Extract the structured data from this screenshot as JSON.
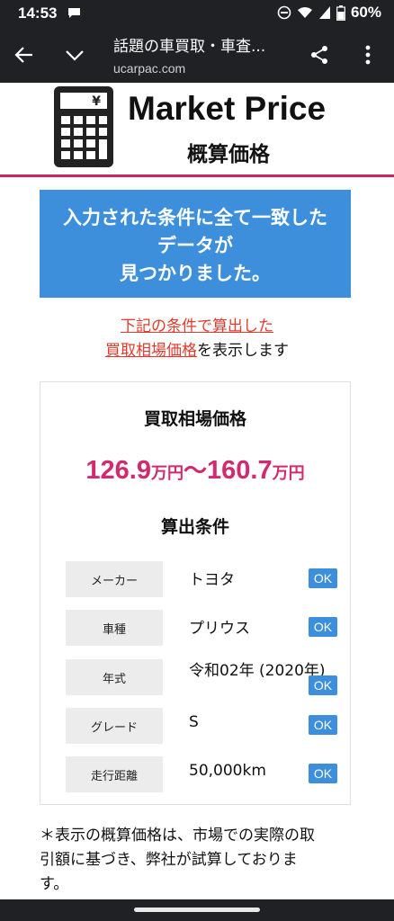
{
  "status": {
    "time": "14:53",
    "battery": "60%"
  },
  "browser": {
    "title": "話題の車買取・車査...",
    "url": "ucarpac.com"
  },
  "header": {
    "title": "Market Price",
    "subtitle": "概算価格",
    "calc_symbol": "¥"
  },
  "banner": {
    "line1": "入力された条件に全て一致した",
    "line2": "データが",
    "line3": "見つかりました。"
  },
  "notice": {
    "link1": "下記の条件で算出した",
    "link2": "買取相場価格",
    "suffix": "を表示します"
  },
  "result": {
    "title": "買取相場価格",
    "price_low": "126.9",
    "price_high": "160.7",
    "unit": "万円",
    "tilde": "～",
    "conditions_title": "算出条件",
    "rows": [
      {
        "label": "メーカー",
        "value": "トヨタ",
        "ok": "OK"
      },
      {
        "label": "車種",
        "value": "プリウス",
        "ok": "OK"
      },
      {
        "label": "年式",
        "value": "令和02年 (2020年)",
        "ok": "OK"
      },
      {
        "label": "グレード",
        "value": "S",
        "ok": "OK"
      },
      {
        "label": "走行距離",
        "value": "50,000km",
        "ok": "OK"
      }
    ]
  },
  "footnote": {
    "line1": "＊表示の概算価格は、市場での実際の取",
    "line2": "引額に基づき、弊社が試算しておりま",
    "line3": "す。"
  }
}
